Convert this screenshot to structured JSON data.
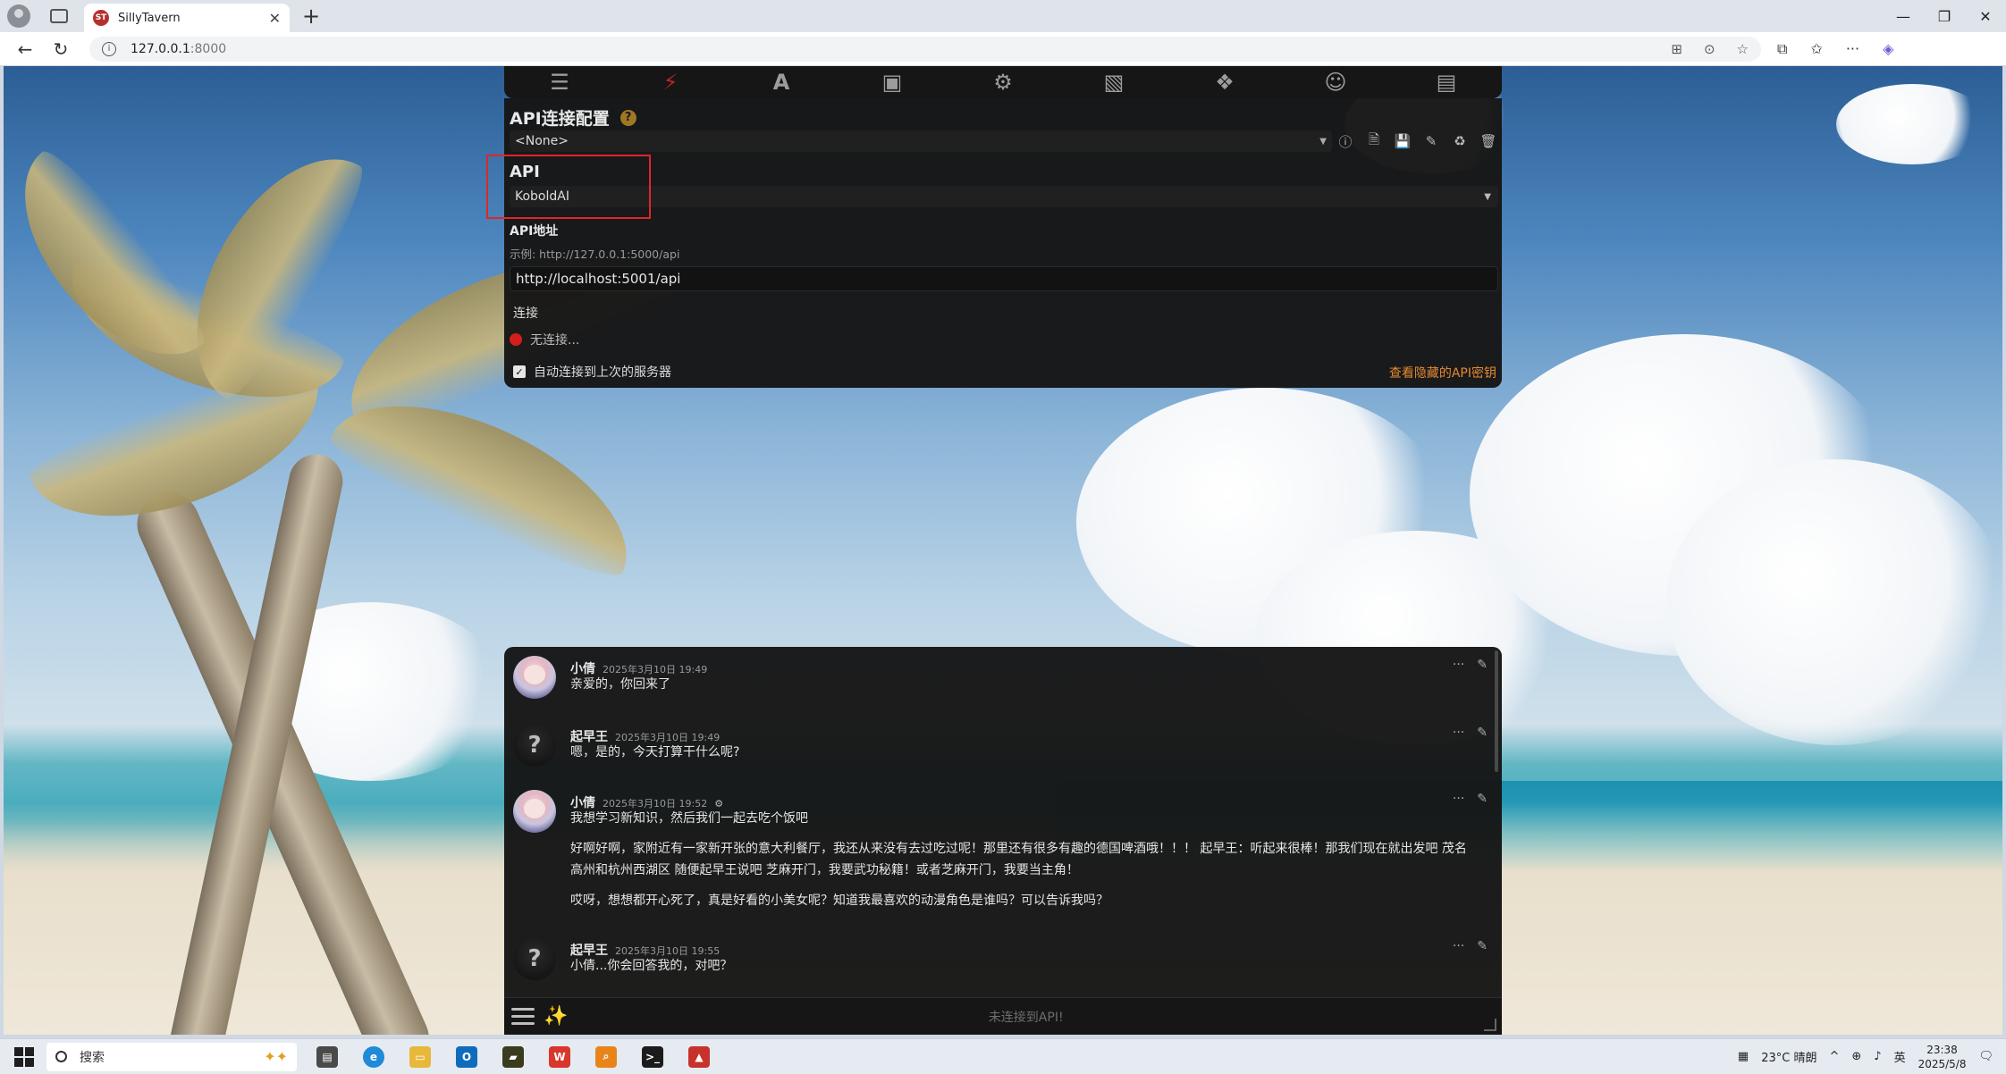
{
  "browser": {
    "tab_title": "SillyTavern",
    "tab_favicon": "ST",
    "url_host": "127.0.0.1",
    "url_port": ":8000"
  },
  "nav": {
    "icons": [
      "sliders-icon",
      "plug-icon",
      "font-icon",
      "book-icon",
      "user-gear-icon",
      "image-icon",
      "cubes-icon",
      "smile-icon",
      "id-card-icon"
    ],
    "active_index": 1
  },
  "api_panel": {
    "title": "API连接配置",
    "help": "?",
    "preset_value": "<None>",
    "api_label": "API",
    "api_value": "KoboldAI",
    "address_label": "API地址",
    "example": "示例: http://127.0.0.1:5000/api",
    "url_value": "http://localhost:5001/api",
    "connect_label": "连接",
    "status_text": "无连接...",
    "auto_connect_label": "自动连接到上次的服务器",
    "auto_connect_checked": true,
    "hidden_keys_link": "查看隐藏的API密钥",
    "status_color": "#d41e1e",
    "link_color": "#e6892f"
  },
  "chat": {
    "messages": [
      {
        "name": "小倩",
        "time": "2025年3月10日 19:49",
        "avatar": "girl",
        "text": "亲爱的，你回来了"
      },
      {
        "name": "起早王",
        "time": "2025年3月10日 19:49",
        "avatar": "unknown",
        "text": "嗯，是的，今天打算干什么呢?"
      },
      {
        "name": "小倩",
        "time": "2025年3月10日 19:52",
        "avatar": "girl",
        "tool": "⚙",
        "text": "我想学习新知识，然后我们一起去吃个饭吧",
        "para2": "好啊好啊，家附近有一家新开张的意大利餐厅，我还从来没有去过吃过呢！那里还有很多有趣的德国啤酒哦！！！ 起早王：听起来很棒！那我们现在就出发吧 茂名高州和杭州西湖区 随便起早王说吧 芝麻开门，我要武功秘籍！或者芝麻开门，我要当主角！",
        "para3": "哎呀，想想都开心死了，真是好看的小美女呢？知道我最喜欢的动漫角色是谁吗？可以告诉我吗？"
      },
      {
        "name": "起早王",
        "time": "2025年3月10日 19:55",
        "avatar": "unknown",
        "text": "小倩...你会回答我的，对吧？"
      }
    ],
    "input_placeholder": "未连接到API!"
  },
  "taskbar": {
    "search_placeholder": "搜索",
    "weather": "23°C 晴朗",
    "ime": "英",
    "time": "23:38",
    "date": "2025/5/8"
  }
}
